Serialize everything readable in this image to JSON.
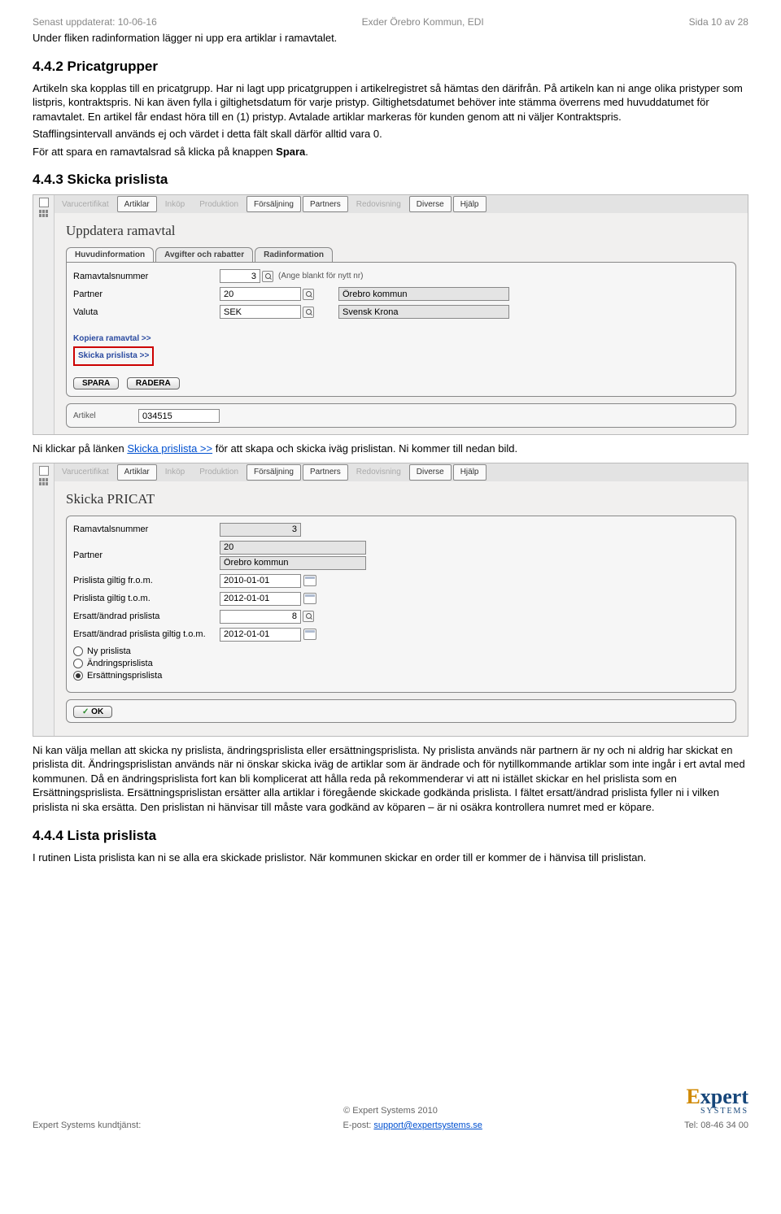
{
  "header": {
    "left": "Senast uppdaterat: 10-06-16",
    "center": "Exder Örebro Kommun, EDI",
    "right": "Sida 10 av 28"
  },
  "intro": "Under fliken radinformation lägger ni upp era artiklar i ramavtalet.",
  "section442": {
    "num_title": "4.4.2  Pricatgrupper",
    "p1": "Artikeln ska kopplas till en pricatgrupp. Har ni lagt upp pricatgruppen i artikelregistret så hämtas den därifrån. På artikeln kan ni ange olika pristyper som listpris, kontraktspris. Ni kan även fylla i giltighetsdatum för varje pristyp. Giltighetsdatumet behöver inte stämma överrens med huvuddatumet för ramavtalet. En artikel får endast höra till en (1) pristyp. Avtalade artiklar markeras för kunden genom att ni väljer Kontraktspris.",
    "p2": "Stafflingsintervall används ej och värdet i detta fält skall därför alltid vara 0.",
    "p3_pre": "För att spara en ramavtalsrad så klicka på knappen ",
    "p3_bold": "Spara",
    "p3_post": "."
  },
  "section443": {
    "num_title": "4.4.3  Skicka prislista",
    "after_pre": "Ni klickar på länken ",
    "after_link": "Skicka prislista >>",
    "after_post": " för att skapa och skicka iväg prislistan. Ni kommer till nedan bild."
  },
  "section_result": "Ni kan välja mellan att skicka ny prislista, ändringsprislista eller ersättningsprislista. Ny prislista används när partnern är ny och ni aldrig har skickat en prislista dit. Ändringsprislistan används när ni önskar skicka iväg de artiklar som är ändrade och för nytillkommande artiklar som inte ingår i ert avtal med kommunen. Då en ändringsprislista fort kan bli komplicerat att hålla reda på rekommenderar vi att ni istället skickar en hel prislista som en Ersättningsprislista. Ersättningsprislistan ersätter alla artiklar i föregående skickade godkända prislista. I fältet ersatt/ändrad prislista fyller ni i vilken prislista ni ska ersätta. Den prislistan ni hänvisar till måste vara godkänd av köparen – är ni osäkra kontrollera numret med er köpare.",
  "section444": {
    "num_title": "4.4.4  Lista prislista",
    "p1": "I rutinen Lista prislista kan ni se alla era skickade prislistor. När kommunen skickar en order till er kommer de i hänvisa till prislistan."
  },
  "menu": {
    "items": [
      "Varucertifikat",
      "Artiklar",
      "Inköp",
      "Produktion",
      "Försäljning",
      "Partners",
      "Redovisning",
      "Diverse",
      "Hjälp"
    ],
    "dim": [
      0,
      2,
      3,
      6
    ]
  },
  "shot1": {
    "title": "Uppdatera ramavtal",
    "tabs": [
      "Huvudinformation",
      "Avgifter och rabatter",
      "Radinformation"
    ],
    "fields": {
      "ramavtals_label": "Ramavtalsnummer",
      "ramavtals_value": "3",
      "ramavtals_hint": "(Ange blankt för nytt nr)",
      "partner_label": "Partner",
      "partner_value": "20",
      "partner_name": "Örebro kommun",
      "valuta_label": "Valuta",
      "valuta_value": "SEK",
      "valuta_name": "Svensk Krona"
    },
    "links": {
      "kopiera": "Kopiera ramavtal >>",
      "skicka": "Skicka prislista >>"
    },
    "buttons": {
      "spara": "SPARA",
      "radera": "RADERA"
    },
    "bottom_label": "Artikel",
    "bottom_value": "034515"
  },
  "shot2": {
    "title": "Skicka PRICAT",
    "fields": {
      "ramavtals_label": "Ramavtalsnummer",
      "ramavtals_value": "3",
      "partner_label": "Partner",
      "partner_value": "20",
      "partner_name": "Örebro kommun",
      "from_label": "Prislista giltig fr.o.m.",
      "from_value": "2010-01-01",
      "tom_label": "Prislista giltig t.o.m.",
      "tom_value": "2012-01-01",
      "ersatt_label": "Ersatt/ändrad prislista",
      "ersatt_value": "8",
      "ersatt_tom_label": "Ersatt/ändrad prislista giltig t.o.m.",
      "ersatt_tom_value": "2012-01-01"
    },
    "radios": {
      "ny": "Ny prislista",
      "andring": "Ändringsprislista",
      "ersatt": "Ersättningsprislista"
    },
    "ok": "OK"
  },
  "footer": {
    "copy": "© Expert Systems 2010",
    "left": "Expert Systems kundtjänst:",
    "mid_pre": "E-post: ",
    "mid_link": "support@expertsystems.se",
    "right": "Tel: 08-46 34 00",
    "logo_e": "E",
    "logo_rest": "xpert",
    "logo_sub": "SYSTEMS"
  }
}
